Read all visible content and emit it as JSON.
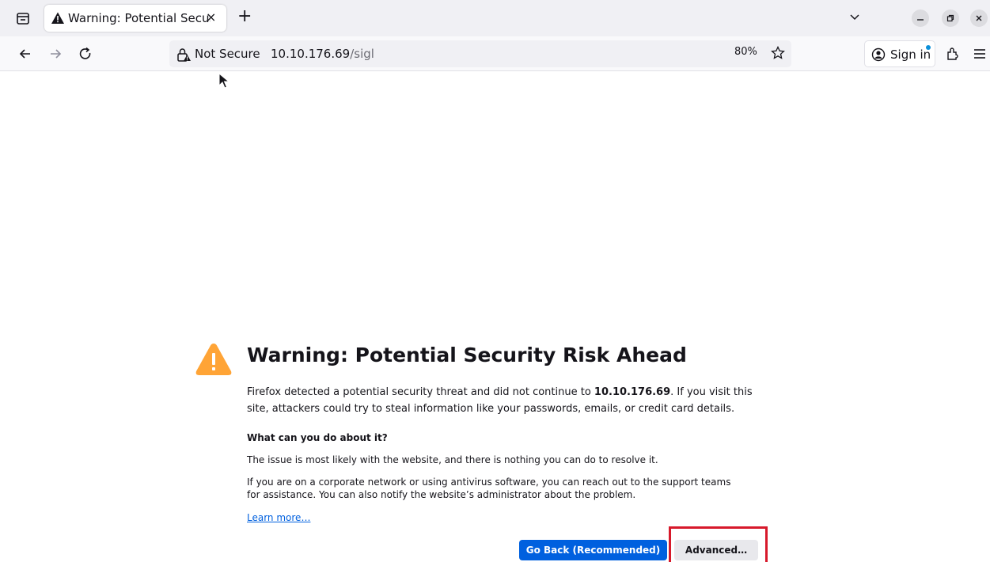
{
  "browser": {
    "tab": {
      "title": "Warning: Potential Securi",
      "close_label": "×"
    },
    "new_tab_label": "+",
    "url": {
      "security_label": "Not Secure",
      "host": "10.10.176.69",
      "path": "/sigl",
      "zoom": "80%"
    },
    "signin_label": "Sign in"
  },
  "error_page": {
    "title": "Warning: Potential Security Risk Ahead",
    "intro_pre": "Firefox detected a potential security threat and did not continue to ",
    "intro_host": "10.10.176.69",
    "intro_post": ". If you visit this site, attackers could try to steal information like your passwords, emails, or credit card details.",
    "what_heading": "What can you do about it?",
    "para1": "The issue is most likely with the website, and there is nothing you can do to resolve it.",
    "para2": "If you are on a corporate network or using antivirus software, you can reach out to the support teams for assistance. You can also notify the website’s administrator about the problem.",
    "learn_more": "Learn more…",
    "go_back_label": "Go Back (Recommended)",
    "advanced_label": "Advanced…"
  },
  "icons": {
    "tab_icon": "warning-icon",
    "toolbar": [
      "list-all-tabs-icon",
      "back-icon",
      "forward-icon",
      "reload-icon",
      "insecure-lock-icon",
      "star-icon",
      "account-icon",
      "extensions-icon",
      "menu-icon"
    ]
  },
  "colors": {
    "accent": "#0060df",
    "warning": "#ffa436",
    "highlight": "#d7192b"
  }
}
